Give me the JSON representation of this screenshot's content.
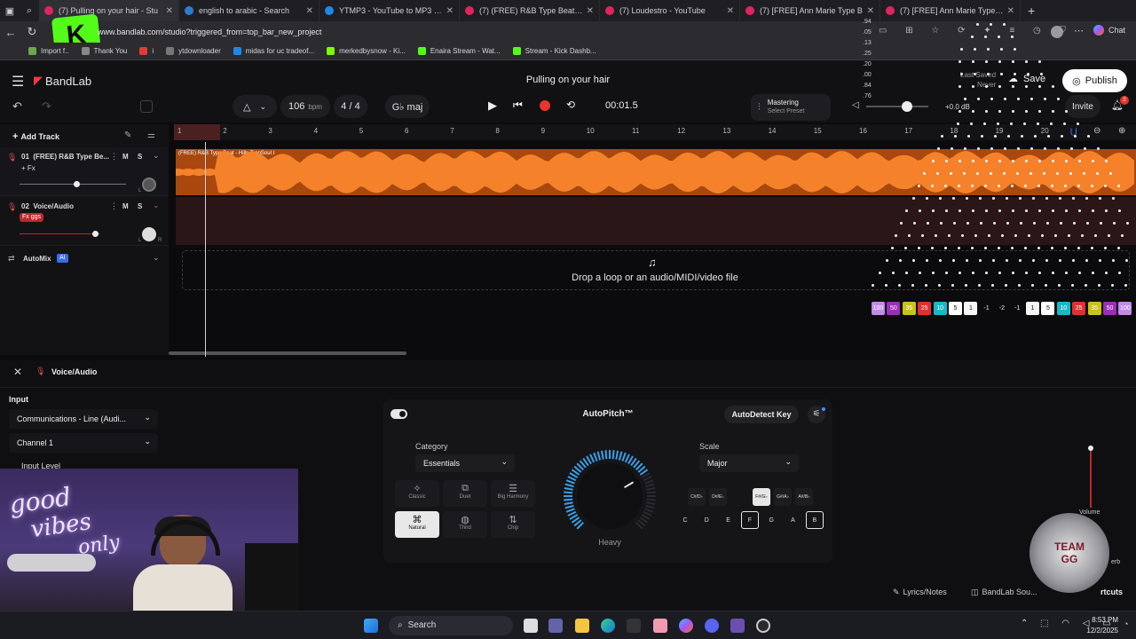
{
  "browser": {
    "tabs": [
      {
        "title": "(7) Pulling on your hair - Stu",
        "active": true,
        "icon_color": "#e0245e"
      },
      {
        "title": "english to arabic - Search",
        "icon_color": "#2f7bd1"
      },
      {
        "title": "YTMP3 - YouTube to MP3 Conve",
        "icon_color": "#1e88e5"
      },
      {
        "title": "(7) (FREE) R&B Type Beat - \"U &",
        "icon_color": "#e0245e"
      },
      {
        "title": "(7) Loudestro - YouTube",
        "icon_color": "#e0245e"
      },
      {
        "title": "(7) [FREE] Ann Marie Type B",
        "icon_color": "#e0245e"
      },
      {
        "title": "(7) [FREE] Ann Marie Type Beat \"",
        "icon_color": "#e0245e"
      }
    ],
    "url": "www.bandlab.com/studio?triggered_from=top_bar_new_project",
    "bookmarks": [
      {
        "label": "Import f..",
        "color": "#6aa84f"
      },
      {
        "label": "Thank You",
        "color": "#888888"
      },
      {
        "label": "i",
        "color": "#e53935"
      },
      {
        "label": "ytdownloader",
        "color": "#777777"
      },
      {
        "label": "midas for uc tradeof...",
        "color": "#1e88e5"
      },
      {
        "label": "merkedbysnow - Ki...",
        "color": "#7cfc00"
      },
      {
        "label": "Enaira Stream - Wat...",
        "color": "#53fc18"
      },
      {
        "label": "Stream - Kick Dashb...",
        "color": "#53fc18"
      }
    ],
    "chat_label": "Chat"
  },
  "studio": {
    "brand": "BandLab",
    "project_title": "Pulling on your hair",
    "last_saved_label": "Last Saved",
    "last_saved_value": "Never",
    "save_label": "Save",
    "publish_label": "Publish",
    "invite_label": "Invite",
    "notification_count": "2",
    "bpm_value": "106",
    "bpm_unit": "bpm",
    "time_signature": "4 / 4",
    "key": "G♭ maj",
    "time_display": "00:01.5",
    "mastering_label": "Mastering",
    "mastering_preset": "Select Preset",
    "volume_db": "+0.0 dB",
    "add_track_label": "Add Track",
    "tracks": [
      {
        "number": "01",
        "name": "(FREE) R&B Type Be...",
        "fx": "+ Fx",
        "clip_label": "(FREE) R&B Type Beat - Hills  TropSoul I"
      },
      {
        "number": "02",
        "name": "Voice/Audio",
        "fx": "Fx ggs"
      }
    ],
    "mute_label": "M",
    "solo_label": "S",
    "lr_label": "L",
    "lr_label_r": "R",
    "automix_label": "AutoMix",
    "automix_badge": "AI",
    "drop_text": "Drop a loop or an audio/MIDI/video file",
    "ruler_ticks": [
      "1",
      "2",
      "3",
      "4",
      "5",
      "6",
      "7",
      "8",
      "9",
      "10",
      "11",
      "12",
      "13",
      "14",
      "15",
      "16",
      "17",
      "18",
      "19",
      "20"
    ],
    "meter_scale": [
      ".94",
      ".05",
      ".13",
      ".25",
      ".20",
      ".00",
      ".84",
      ".76"
    ]
  },
  "level_badges": {
    "left": [
      {
        "label": "100",
        "color": "#c18ae8"
      },
      {
        "label": "50",
        "color": "#9b2fb5"
      },
      {
        "label": "35",
        "color": "#c9c21a"
      },
      {
        "label": "25",
        "color": "#e03030"
      },
      {
        "label": "10",
        "color": "#19b8c9"
      },
      {
        "label": "5",
        "color": "#ffffff"
      },
      {
        "label": "1",
        "color": "#f5f5f5"
      }
    ],
    "mid": [
      "-1",
      "-2",
      "-1"
    ],
    "right": [
      {
        "label": "1",
        "color": "#f5f5f5"
      },
      {
        "label": "5",
        "color": "#ffffff"
      },
      {
        "label": "10",
        "color": "#19b8c9"
      },
      {
        "label": "25",
        "color": "#e03030"
      },
      {
        "label": "35",
        "color": "#c9c21a"
      },
      {
        "label": "50",
        "color": "#9b2fb5"
      },
      {
        "label": "100",
        "color": "#c18ae8"
      }
    ]
  },
  "bottom": {
    "panel_title": "Voice/Audio",
    "input_label": "Input",
    "input_device": "Communications - Line (Audi...",
    "channel": "Channel 1",
    "input_level_label": "Input Level",
    "autopitch_title": "AutoPitch™",
    "autodetect_label": "AutoDetect Key",
    "category_label": "Category",
    "category_value": "Essentials",
    "scale_label": "Scale",
    "scale_value": "Major",
    "knob_label": "Heavy",
    "knob_level": 0.72,
    "categories": [
      {
        "name": "Classic",
        "icon": "sparkle-icon",
        "glyph": "✧"
      },
      {
        "name": "Duet",
        "icon": "duet-icon",
        "glyph": "⧉"
      },
      {
        "name": "Big Harmony",
        "icon": "harmony-icon",
        "glyph": "☰"
      },
      {
        "name": "Natural",
        "icon": "natural-icon",
        "glyph": "⌘",
        "selected": true
      },
      {
        "name": "Third",
        "icon": "third-icon",
        "glyph": "◍"
      },
      {
        "name": "Chip",
        "icon": "chip-icon",
        "glyph": "⇅"
      }
    ],
    "sharps": [
      {
        "label": "C#/D♭"
      },
      {
        "label": "D#/E♭"
      },
      {
        "label": "F#/G♭",
        "selected": true
      },
      {
        "label": "G#/A♭"
      },
      {
        "label": "A#/B♭"
      }
    ],
    "naturals": [
      {
        "label": "C"
      },
      {
        "label": "D"
      },
      {
        "label": "E"
      },
      {
        "label": "F",
        "selected": true
      },
      {
        "label": "G"
      },
      {
        "label": "A"
      },
      {
        "label": "B",
        "selected": true
      }
    ],
    "volume_label": "Volume",
    "verb_label": "erb",
    "lyrics_label": "Lyrics/Notes",
    "sounds_label": "BandLab Sou...",
    "shortcuts_label": "rtcuts"
  },
  "webcam": {
    "neon_text_1": "good",
    "neon_text_2": "vibes",
    "neon_text_3": "only",
    "badge_text": "TEAM GG"
  },
  "taskbar": {
    "search_label": "Search",
    "time": "8:53 PM",
    "date": "12/2/2025"
  },
  "colors": {
    "accent_orange": "#f08020",
    "record_red": "#e8342a",
    "bandlab_red": "#f03c3c"
  }
}
